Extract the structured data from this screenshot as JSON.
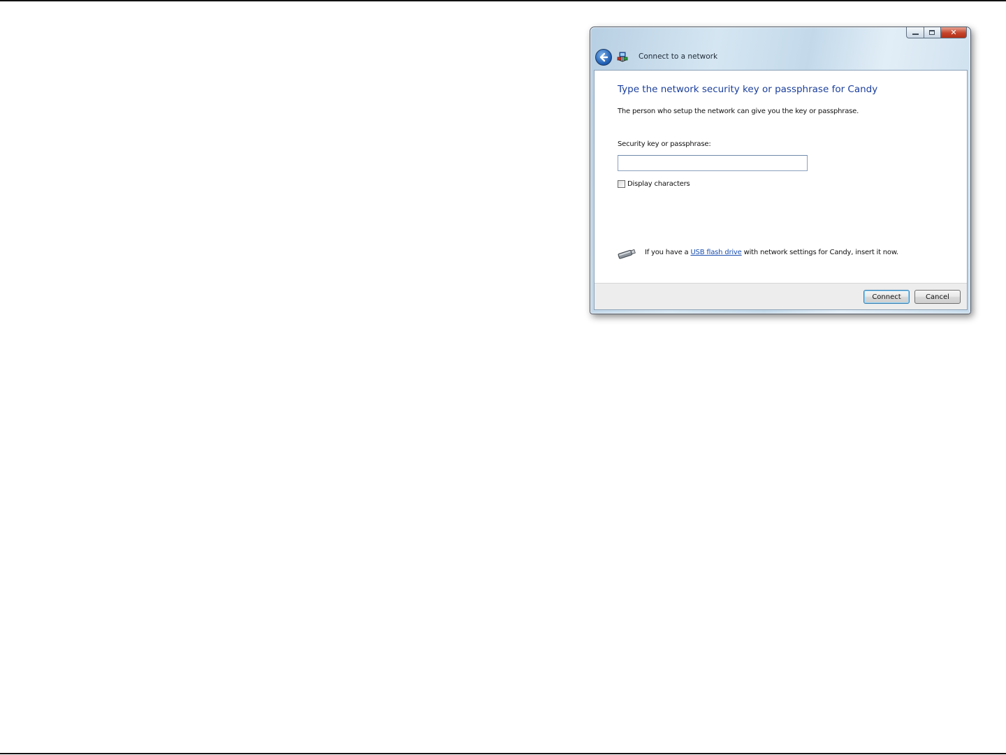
{
  "window": {
    "title": "Connect to a network",
    "caption_buttons": {
      "minimize_icon": "minimize-icon",
      "maximize_icon": "maximize-icon",
      "close_glyph": "✕"
    },
    "nav": {
      "back_icon": "back-arrow-icon",
      "app_icon": "network-connect-icon"
    }
  },
  "content": {
    "heading": "Type the network security key or passphrase for Candy",
    "description": "The person who setup the network can give you the key or passphrase.",
    "key_field": {
      "label": "Security key or passphrase:",
      "value": "",
      "placeholder": ""
    },
    "display_characters": {
      "label": "Display characters",
      "checked": false
    },
    "usb_notice": {
      "icon": "usb-flash-drive-icon",
      "prefix": "If you have a ",
      "link_text": "USB flash drive",
      "suffix": " with network settings for Candy, insert it now."
    }
  },
  "footer": {
    "connect_label": "Connect",
    "cancel_label": "Cancel"
  },
  "colors": {
    "heading": "#1a3e9c",
    "link": "#1a4fb0",
    "footer_bg": "#ededed",
    "frame_glass": "#c8dcec",
    "close_button": "#c5432b"
  }
}
